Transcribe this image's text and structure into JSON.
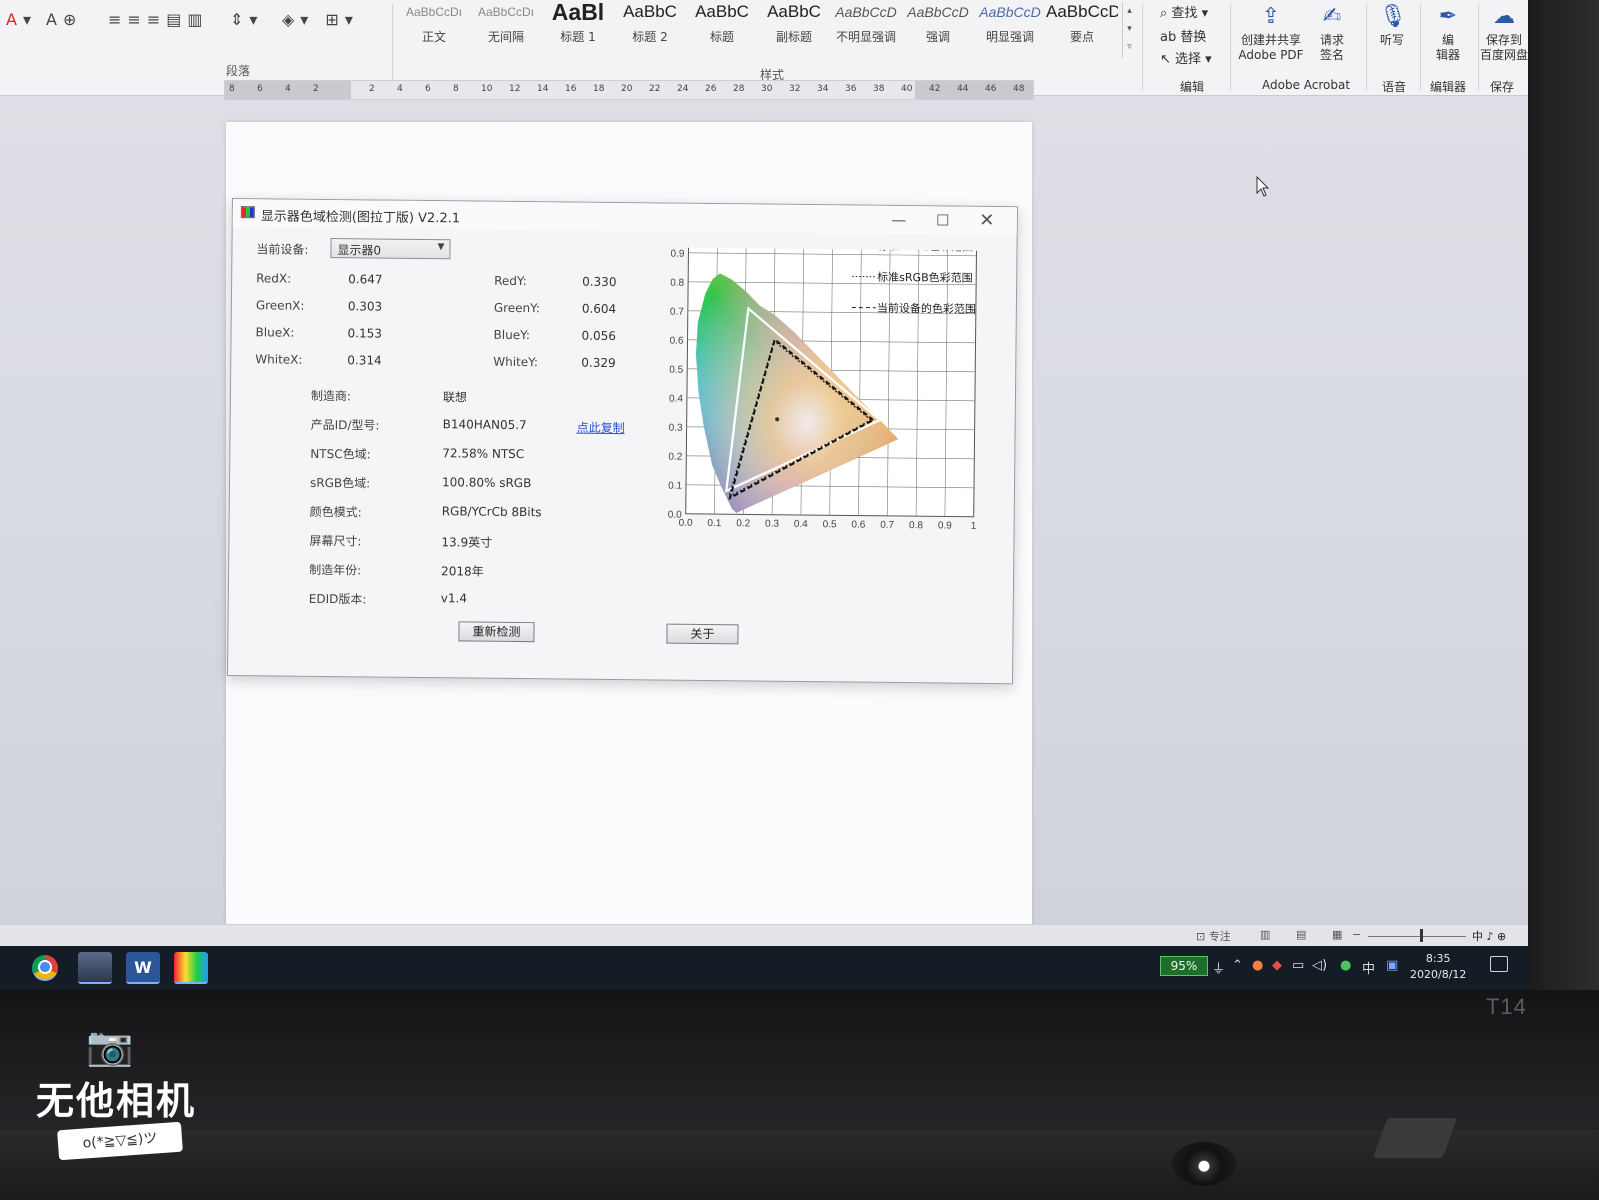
{
  "ribbon": {
    "paragraph_label": "段落",
    "styles_label": "样式",
    "styles": [
      {
        "sample": "AaBbCcDı",
        "name": "正文",
        "kind": "sm"
      },
      {
        "sample": "AaBbCcDı",
        "name": "无间隔",
        "kind": "sm"
      },
      {
        "sample": "AaBl",
        "name": "标题 1",
        "kind": "big"
      },
      {
        "sample": "AaBbC",
        "name": "标题 2",
        "kind": "mid"
      },
      {
        "sample": "AaBbC",
        "name": "标题",
        "kind": "mid"
      },
      {
        "sample": "AaBbC",
        "name": "副标题",
        "kind": "mid"
      },
      {
        "sample": "AaBbCcD",
        "name": "不明显强调",
        "kind": "it"
      },
      {
        "sample": "AaBbCcD",
        "name": "强调",
        "kind": "it"
      },
      {
        "sample": "AaBbCcD",
        "name": "明显强调",
        "kind": "it2"
      },
      {
        "sample": "AaBbCcD",
        "name": "要点",
        "kind": "mid"
      }
    ],
    "editing": {
      "find": "查找",
      "replace": "替换",
      "select": "选择",
      "label": "编辑"
    },
    "acrobat": {
      "create_pdf": "创建并共享",
      "create_pdf2": "Adobe PDF",
      "sign": "请求",
      "sign2": "签名",
      "label": "Adobe Acrobat"
    },
    "voice": {
      "dictate": "听写",
      "label": "语音"
    },
    "editor": {
      "btn": "编",
      "btn2": "辑器",
      "label": "编辑器"
    },
    "save": {
      "btn": "保存到",
      "btn2": "百度网盘",
      "label": "保存"
    }
  },
  "ruler": {
    "ticks": [
      "8",
      "6",
      "4",
      "2",
      "",
      "2",
      "4",
      "6",
      "8",
      "10",
      "12",
      "14",
      "16",
      "18",
      "20",
      "22",
      "24",
      "26",
      "28",
      "30",
      "32",
      "34",
      "36",
      "38",
      "40",
      "42",
      "44",
      "46",
      "48"
    ]
  },
  "dialog": {
    "title": "显示器色域检测(图拉丁版) V2.2.1",
    "device_label": "当前设备:",
    "device_value": "显示器0",
    "coords": {
      "red_x_label": "RedX:",
      "red_x": "0.647",
      "green_x_label": "GreenX:",
      "green_x": "0.303",
      "blue_x_label": "BlueX:",
      "blue_x": "0.153",
      "white_x_label": "WhiteX:",
      "white_x": "0.314",
      "red_y_label": "RedY:",
      "red_y": "0.330",
      "green_y_label": "GreenY:",
      "green_y": "0.604",
      "blue_y_label": "BlueY:",
      "blue_y": "0.056",
      "white_y_label": "WhiteY:",
      "white_y": "0.329"
    },
    "info": [
      {
        "label": "制造商:",
        "value": "联想"
      },
      {
        "label": "产品ID/型号:",
        "value": "B140HAN05.7"
      },
      {
        "label": "NTSC色域:",
        "value": "72.58% NTSC"
      },
      {
        "label": "sRGB色域:",
        "value": "100.80% sRGB"
      },
      {
        "label": "颜色模式:",
        "value": "RGB/YCrCb 8Bits"
      },
      {
        "label": "屏幕尺寸:",
        "value": "13.9英寸"
      },
      {
        "label": "制造年份:",
        "value": "2018年"
      },
      {
        "label": "EDID版本:",
        "value": "v1.4"
      }
    ],
    "copy_link": "点此复制",
    "recheck_button": "重新检测",
    "about_button": "关于"
  },
  "chart_data": {
    "type": "scatter",
    "x_ticks": [
      "0.0",
      "0.1",
      "0.2",
      "0.3",
      "0.4",
      "0.5",
      "0.6",
      "0.7",
      "0.8",
      "0.9",
      "1"
    ],
    "y_ticks": [
      "0.0",
      "0.1",
      "0.2",
      "0.3",
      "0.4",
      "0.5",
      "0.6",
      "0.7",
      "0.8",
      "0.9",
      "1.0"
    ],
    "xlim": [
      0,
      1
    ],
    "ylim": [
      0,
      1
    ],
    "grid": true,
    "legend": [
      {
        "label": "标准NTSC色彩范围",
        "style": "solid"
      },
      {
        "label": "标准sRGB色彩范围",
        "style": "dotted"
      },
      {
        "label": "当前设备的色彩范围",
        "style": "dashed"
      }
    ],
    "series": [
      {
        "name": "标准NTSC色彩范围",
        "points": [
          [
            0.67,
            0.33
          ],
          [
            0.21,
            0.71
          ],
          [
            0.14,
            0.08
          ]
        ],
        "color": "#ffffff"
      },
      {
        "name": "标准sRGB色彩范围",
        "points": [
          [
            0.64,
            0.33
          ],
          [
            0.3,
            0.6
          ],
          [
            0.15,
            0.06
          ]
        ],
        "color": "#222222"
      },
      {
        "name": "当前设备的色彩范围",
        "points": [
          [
            0.647,
            0.33
          ],
          [
            0.303,
            0.604
          ],
          [
            0.153,
            0.056
          ]
        ],
        "color": "#111111"
      }
    ],
    "white_point": [
      0.314,
      0.329
    ]
  },
  "document_status": {
    "focus": "专注",
    "ime": "中 ♪ ⊕"
  },
  "taskbar": {
    "battery": "95%",
    "ime": "中",
    "time": "8:35",
    "date": "2020/8/12"
  },
  "watermark": {
    "text": "无他相机",
    "banner": "o(*≧▽≦)ツ"
  },
  "laptop": {
    "model": "T14"
  }
}
